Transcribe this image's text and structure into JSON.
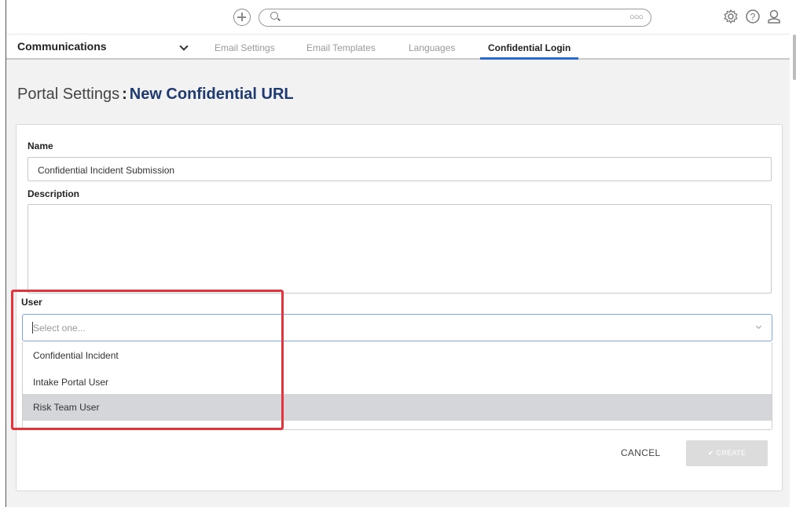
{
  "header": {
    "search_placeholder": "",
    "icons": [
      "add-icon",
      "search-icon",
      "ellipsis-icon",
      "gear-icon",
      "help-icon",
      "user-icon"
    ]
  },
  "nav": {
    "module": "Communications",
    "tabs": [
      {
        "label": "Email Settings",
        "active": false
      },
      {
        "label": "Email Templates",
        "active": false
      },
      {
        "label": "Languages",
        "active": false
      },
      {
        "label": "Confidential Login",
        "active": true
      }
    ]
  },
  "page": {
    "title": "Portal Settings",
    "separator": ":",
    "subtitle": "New Confidential URL"
  },
  "form": {
    "name_label": "Name",
    "name_value": "Confidential Incident Submission",
    "description_label": "Description",
    "description_value": "",
    "user_label": "User",
    "user_placeholder": "Select one...",
    "user_options": [
      "Confidential Incident",
      "Intake Portal User",
      "Risk Team User"
    ],
    "highlighted_option": "Risk Team User"
  },
  "actions": {
    "cancel_label": "CANCEL",
    "create_label": "✔ CREATE"
  },
  "colors": {
    "accent": "#2b6ad6",
    "highlight_box": "#e5333b",
    "option_hover": "#d4d6d9"
  }
}
